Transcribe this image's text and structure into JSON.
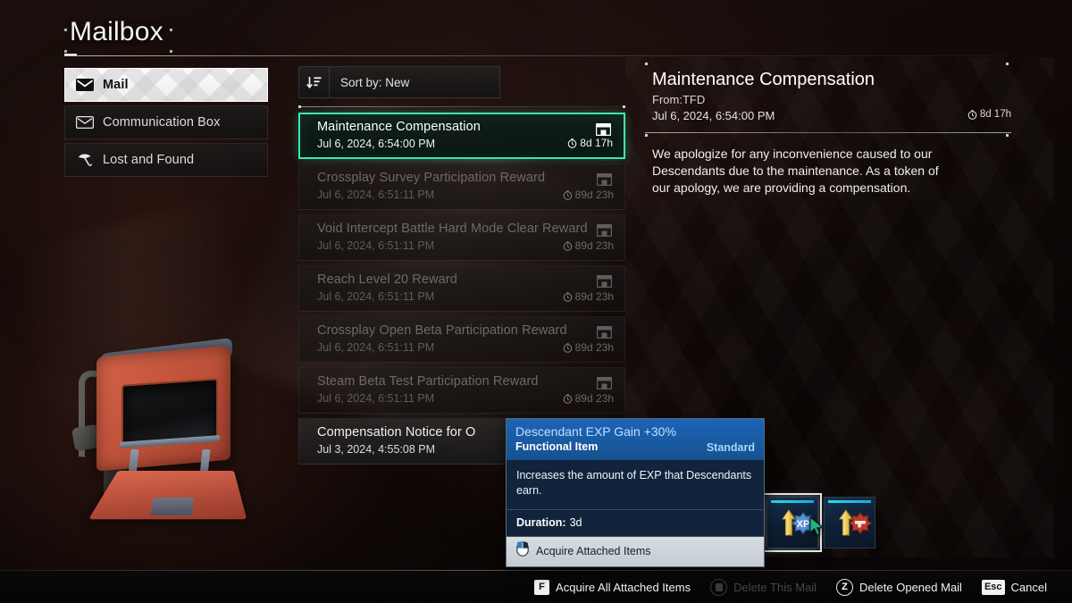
{
  "page": {
    "title": "Mailbox"
  },
  "sidebar": {
    "items": [
      {
        "label": "Mail",
        "icon": "envelope-icon",
        "active": true
      },
      {
        "label": "Communication Box",
        "icon": "envelope-icon",
        "active": false
      },
      {
        "label": "Lost and Found",
        "icon": "umbrella-icon",
        "active": false
      }
    ]
  },
  "mail_list": {
    "sort": {
      "icon": "sort-descending-icon",
      "label": "Sort by: New"
    },
    "items": [
      {
        "title": "Maintenance Compensation",
        "date": "Jul 6, 2024, 6:54:00 PM",
        "expires": "8d 17h",
        "icon": "inbox-icon",
        "state": "selected"
      },
      {
        "title": "Crossplay Survey Participation Reward",
        "date": "Jul 6, 2024, 6:51:11 PM",
        "expires": "89d 23h",
        "icon": "inbox-icon",
        "state": "unread"
      },
      {
        "title": "Void Intercept Battle Hard Mode Clear Reward",
        "date": "Jul 6, 2024, 6:51:11 PM",
        "expires": "89d 23h",
        "icon": "inbox-icon",
        "state": "unread"
      },
      {
        "title": "Reach Level 20 Reward",
        "date": "Jul 6, 2024, 6:51:11 PM",
        "expires": "89d 23h",
        "icon": "inbox-icon",
        "state": "unread"
      },
      {
        "title": "Crossplay Open Beta Participation Reward",
        "date": "Jul 6, 2024, 6:51:11 PM",
        "expires": "89d 23h",
        "icon": "inbox-icon",
        "state": "unread"
      },
      {
        "title": "Steam Beta Test Participation Reward",
        "date": "Jul 6, 2024, 6:51:11 PM",
        "expires": "89d 23h",
        "icon": "inbox-icon",
        "state": "unread"
      },
      {
        "title": "Compensation Notice for O",
        "date": "Jul 3, 2024, 4:55:08 PM",
        "expires": "",
        "icon": "",
        "state": "read"
      }
    ]
  },
  "detail": {
    "title": "Maintenance Compensation",
    "from": "From:TFD",
    "date": "Jul 6, 2024, 6:54:00 PM",
    "expires": "8d 17h",
    "body": "We apologize for any inconvenience caused to our Descendants due to the maintenance. As a token of our apology, we are providing a compensation.",
    "attachments": [
      {
        "name": "exp-boost-item",
        "badge": "XP",
        "badge_color": "#5b8fd6",
        "arrow_color": "#e0b83c",
        "focused": true
      },
      {
        "name": "weapon-boost-item",
        "badge": "gun-icon",
        "badge_color": "#c0392b",
        "arrow_color": "#e0b83c",
        "focused": false
      }
    ]
  },
  "tooltip": {
    "name": "Descendant EXP Gain +30%",
    "type": "Functional Item",
    "grade": "Standard",
    "description": "Increases the amount of EXP that Descendants earn.",
    "duration_label": "Duration:",
    "duration_value": "3d",
    "action_icon": "mouse-left-click-icon",
    "action_label": "Acquire Attached Items"
  },
  "action_bar": {
    "actions": [
      {
        "key": "F",
        "label": "Acquire All Attached Items",
        "style": "square",
        "disabled": false
      },
      {
        "key": "",
        "label": "Delete This Mail",
        "style": "square-dim",
        "disabled": true
      },
      {
        "key": "Z",
        "label": "Delete Opened Mail",
        "style": "round",
        "disabled": false
      },
      {
        "key": "Esc",
        "label": "Cancel",
        "style": "square",
        "disabled": false
      }
    ]
  },
  "colors": {
    "accent_green": "#3fe8a8",
    "tooltip_blue": "#1d64b8",
    "slot_cyan": "#2fd9e8"
  }
}
